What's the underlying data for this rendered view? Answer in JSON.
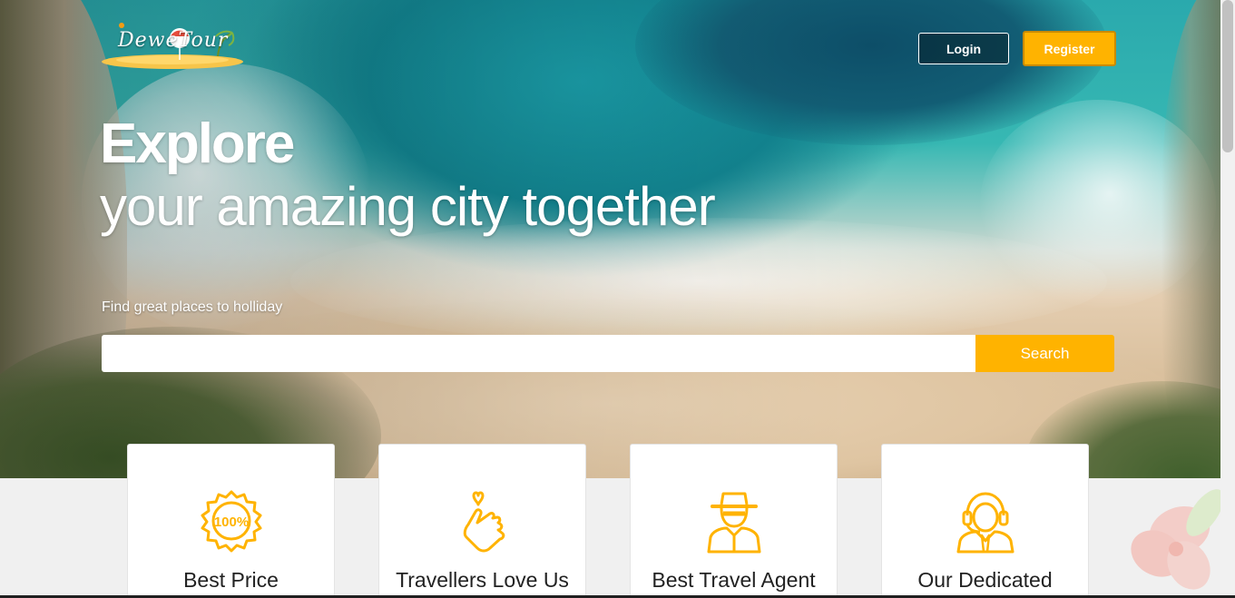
{
  "header": {
    "logo_text": "DeweTour",
    "login_label": "Login",
    "register_label": "Register"
  },
  "hero": {
    "headline_strong": "Explore",
    "headline_light": "your amazing city together",
    "subtitle": "Find great places to holliday"
  },
  "search": {
    "placeholder": "",
    "value": "",
    "button_label": "Search"
  },
  "features": [
    {
      "title": "Best Price",
      "icon": "badge-100-percent-icon"
    },
    {
      "title": "Travellers Love Us",
      "icon": "finger-heart-icon"
    },
    {
      "title": "Best Travel Agent",
      "icon": "travel-agent-icon"
    },
    {
      "title": "Our Dedicated",
      "icon": "support-headset-icon"
    }
  ],
  "colors": {
    "accent": "#ffb300",
    "accent_border": "#c98a00",
    "icon": "#ffb300",
    "card_bg": "#ffffff",
    "section_bg": "#f0f0f0"
  }
}
